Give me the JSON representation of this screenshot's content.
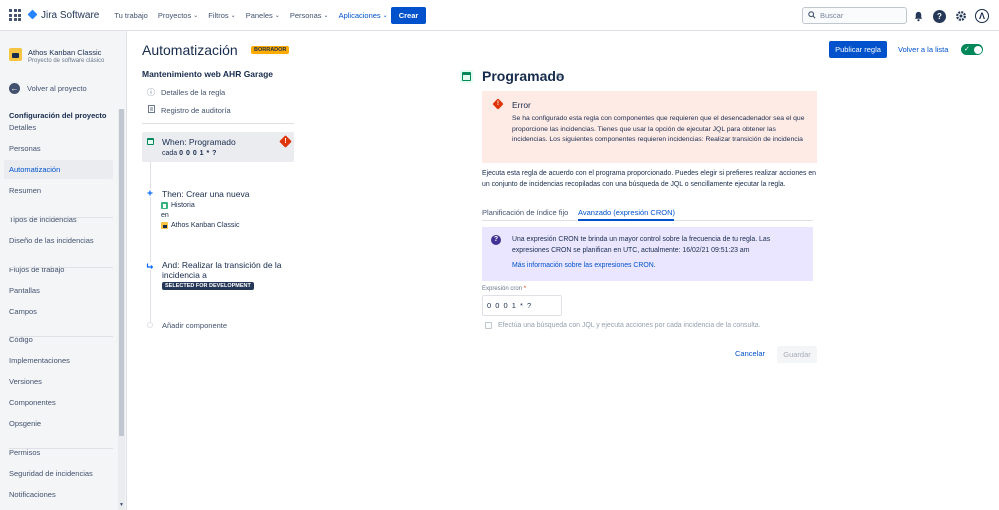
{
  "topnav": {
    "logo_text": "Jira Software",
    "items": [
      {
        "label": "Tu trabajo",
        "chevron": false,
        "active": false
      },
      {
        "label": "Proyectos",
        "chevron": true,
        "active": false
      },
      {
        "label": "Filtros",
        "chevron": true,
        "active": false
      },
      {
        "label": "Paneles",
        "chevron": true,
        "active": false
      },
      {
        "label": "Personas",
        "chevron": true,
        "active": false
      },
      {
        "label": "Aplicaciones",
        "chevron": true,
        "active": true
      }
    ],
    "create_label": "Crear",
    "search_placeholder": "Buscar",
    "avatar_letter": "Λ"
  },
  "sidebar": {
    "project_name": "Athos Kanban Classic",
    "project_type": "Proyecto de software clásico",
    "back_label": "Volver al proyecto",
    "section_title": "Configuración del proyecto",
    "items": [
      {
        "label": "Detalles",
        "active": false
      },
      {
        "label": "Personas",
        "active": false
      },
      {
        "label": "Automatización",
        "active": true
      },
      {
        "label": "Resumen",
        "active": false
      },
      {
        "label": "Tipos de incidencias",
        "active": false
      },
      {
        "label": "Diseño de las incidencias",
        "active": false
      },
      {
        "label": "Flujos de trabajo",
        "active": false
      },
      {
        "label": "Pantallas",
        "active": false
      },
      {
        "label": "Campos",
        "active": false
      },
      {
        "label": "Código",
        "active": false
      },
      {
        "label": "Implementaciones",
        "active": false
      },
      {
        "label": "Versiones",
        "active": false
      },
      {
        "label": "Componentes",
        "active": false
      },
      {
        "label": "Opsgenie",
        "active": false
      },
      {
        "label": "Permisos",
        "active": false
      },
      {
        "label": "Seguridad de incidencias",
        "active": false
      },
      {
        "label": "Notificaciones",
        "active": false
      }
    ]
  },
  "automation": {
    "title": "Automatización",
    "draft_label": "BORRADOR",
    "rule_name": "Mantenimiento web AHR Garage",
    "rule_details_label": "Detalles de la regla",
    "audit_log_label": "Registro de auditoría",
    "trigger": {
      "title": "When: Programado",
      "prefix": "cada",
      "cron": "0 0 0 1 * ?"
    },
    "action1": {
      "title": "Then: Crear una nueva",
      "issue_type": "Historia",
      "in_label": "en",
      "project": "Athos Kanban Classic"
    },
    "action2": {
      "title_line1": "And: Realizar la transición de la",
      "title_line2": "incidencia a",
      "status": "SELECTED FOR DEVELOPMENT"
    },
    "add_component_label": "Añadir componente"
  },
  "right": {
    "publish_label": "Publicar regla",
    "back_to_list_label": "Volver a la lista",
    "section_title": "Programado",
    "error": {
      "title": "Error",
      "body": "Se ha configurado esta regla con componentes que requieren que el desencadenador sea el que proporcione las incidencias. Tienes que usar la opción de ejecutar JQL para obtener las incidencias. Los siguientes componentes requieren incidencias: Realizar transición de incidencia"
    },
    "description": "Ejecuta esta regla de acuerdo con el programa proporcionado. Puedes elegir si prefieres realizar acciones en un conjunto de incidencias recopiladas con una búsqueda de JQL o sencillamente ejecutar la regla.",
    "tabs": [
      {
        "label": "Planificación de índice fijo",
        "active": false
      },
      {
        "label": "Avanzado (expresión CRON)",
        "active": true
      }
    ],
    "info": {
      "text": "Una expresión CRON te brinda un mayor control sobre la frecuencia de tu regla. Las expresiones CRON se planifican en UTC, actualmente: 16/02/21 09:51:23 am",
      "link": "Más información sobre las expresiones CRON."
    },
    "cron_label": "Expresión cron",
    "cron_required": "*",
    "cron_value": "0 0 0 1 * ?",
    "jql_checkbox_label": "Efectúa una búsqueda con JQL y ejecuta acciones por cada incidencia de la consulta.",
    "jql_checked": false,
    "cancel_label": "Cancelar",
    "save_label": "Guardar",
    "rule_enabled": true
  },
  "colors": {
    "brand_blue": "#0052cc",
    "error_red": "#de350b",
    "success_green": "#00875a",
    "draft_yellow": "#ffab00"
  }
}
